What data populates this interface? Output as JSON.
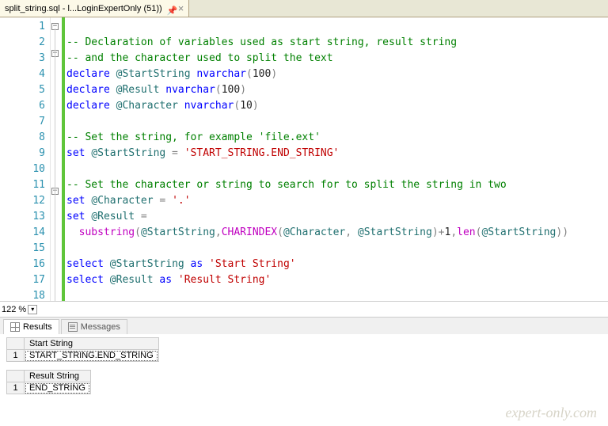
{
  "tab": {
    "title": "split_string.sql - l...LoginExpertOnly (51))"
  },
  "gutter": [
    "1",
    "2",
    "3",
    "4",
    "5",
    "6",
    "7",
    "8",
    "9",
    "10",
    "11",
    "12",
    "13",
    "14",
    "15",
    "16",
    "17",
    "18"
  ],
  "code": {
    "l1": "-- Declaration of variables used as start string, result string",
    "l2": "-- and the character used to split the text",
    "l3_kw": "declare",
    "l3_var": "@StartString",
    "l3_ty": "nvarchar",
    "l3_num": "100",
    "l4_kw": "declare",
    "l4_var": "@Result",
    "l4_ty": "nvarchar",
    "l4_num": "100",
    "l5_kw": "declare",
    "l5_var": "@Character",
    "l5_ty": "nvarchar",
    "l5_num": "10",
    "l7": "-- Set the string, for example 'file.ext'",
    "l8_kw": "set",
    "l8_var": "@StartString",
    "l8_eq": " = ",
    "l8_str": "'START_STRING.END_STRING'",
    "l10": "-- Set the character or string to search for to split the string in two",
    "l11_kw": "set",
    "l11_var": "@Character",
    "l11_eq": " = ",
    "l11_str": "'.'",
    "l12_kw": "set",
    "l12_var": "@Result",
    "l12_eq": " =",
    "l13_fn1": "substring",
    "l13_open": "(",
    "l13_v1": "@StartString",
    "l13_c1": ",",
    "l13_fn2": "CHARINDEX",
    "l13_open2": "(",
    "l13_v2": "@Character",
    "l13_c2": ", ",
    "l13_v3": "@StartString",
    "l13_close2": ")",
    "l13_plus": "+",
    "l13_one": "1",
    "l13_c3": ",",
    "l13_fn3": "len",
    "l13_open3": "(",
    "l13_v4": "@StartString",
    "l13_close3": "))",
    "l15_kw": "select",
    "l15_var": "@StartString",
    "l15_as": " as ",
    "l15_str": "'Start String'",
    "l16_kw": "select",
    "l16_var": "@Result",
    "l16_as": " as ",
    "l16_str": "'Result String'"
  },
  "zoom": {
    "value": "122 %"
  },
  "resultsTabs": {
    "results": "Results",
    "messages": "Messages"
  },
  "grid1": {
    "header": "Start String",
    "row1": "1",
    "cell": "START_STRING.END_STRING"
  },
  "grid2": {
    "header": "Result String",
    "row1": "1",
    "cell": "END_STRING"
  },
  "watermark": "expert-only.com"
}
